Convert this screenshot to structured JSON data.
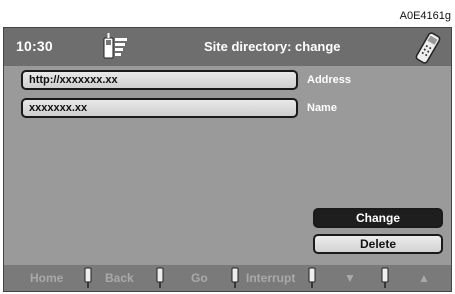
{
  "figure_ref": "A0E4161g",
  "header": {
    "time": "10:30",
    "title": "Site directory: change",
    "icons": [
      "phone-signal-icon",
      "handset-icon"
    ]
  },
  "form": {
    "address_value": "http://xxxxxxx.xx",
    "address_label": "Address",
    "name_value": "xxxxxxx.xx",
    "name_label": "Name"
  },
  "actions": {
    "change_label": "Change",
    "delete_label": "Delete"
  },
  "bottom_nav": {
    "home": "Home",
    "back": "Back",
    "go": "Go",
    "interrupt": "Interrupt",
    "down": "▼",
    "up": "▲"
  },
  "colors": {
    "screen_bg": "#9a9a9a",
    "header_bg": "#6e6e6e",
    "selected_button": "#1e1e1e",
    "inactive_text": "#a9a9a9"
  }
}
